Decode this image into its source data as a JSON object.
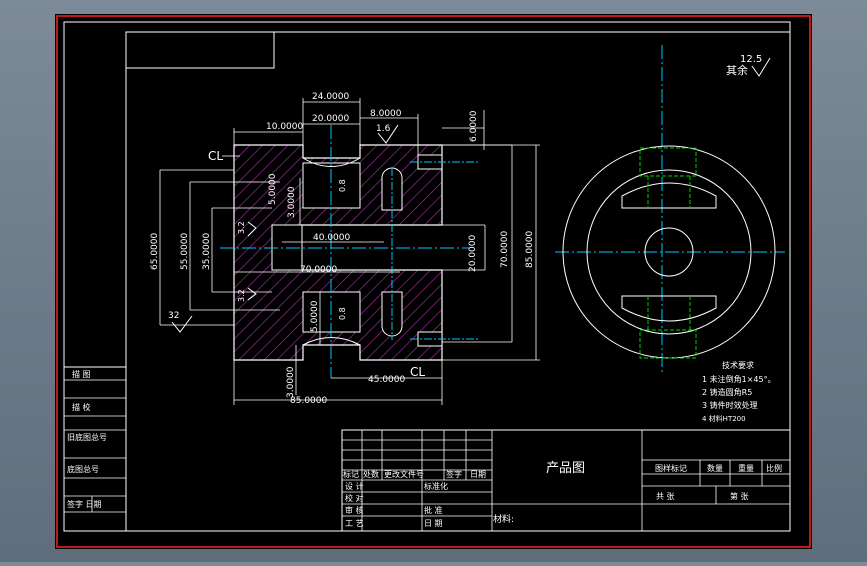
{
  "colors": {
    "background": "#000000",
    "frame": "#ff0000",
    "line": "#ffffff",
    "hatch": "#b030b0",
    "centerline": "#00c8ff",
    "hidden": "#00d000"
  },
  "main_view": {
    "dims": {
      "d24": "24.0000",
      "d20": "20.0000",
      "d8": "8.0000",
      "d10": "10.0000",
      "d6": "6.0000",
      "d5a": "5.0000",
      "d3a": "3.0000",
      "d40": "40.0000",
      "d20b": "20.0000",
      "d70": "70.0000",
      "d70v": "70.0000",
      "d85v": "85.0000",
      "d65": "65.0000",
      "d55": "55.0000",
      "d35": "35.0000",
      "d5b": "5.0000",
      "d45": "45.0000",
      "d3b": "3.0000",
      "d85": "85.0000"
    },
    "labels": {
      "cl_top": "CL",
      "cl_bottom": "CL",
      "rough_16": "1.6",
      "rough_32_left": "32",
      "rough_32_mid_a": "3.2",
      "rough_32_mid_b": "3.2",
      "rough_08_a": "0.8",
      "rough_08_b": "0.8"
    }
  },
  "side_view": {
    "rough_value": "12.5",
    "rough_label": "其余"
  },
  "tech_notes": {
    "title": "技术要求",
    "items": [
      "1 未注倒角1×45°。",
      "2 铸造圆角R5",
      "3 铸件时效处理",
      "4 材料HT200"
    ]
  },
  "left_strip": {
    "rows": [
      "描  图",
      "描  校",
      "旧底图总号",
      "底图总号",
      "签字  日期"
    ]
  },
  "title_block": {
    "product_name": "产品图",
    "material_label": "材料:",
    "rev_headers": [
      "标记",
      "处数",
      "更改文件号",
      "签字",
      "日期"
    ],
    "left_rows": [
      {
        "label": "设  计",
        "value": "标准化"
      },
      {
        "label": "校  对",
        "value": ""
      },
      {
        "label": "审  核",
        "value": "批  准"
      },
      {
        "label": "工  艺",
        "value": "日  期"
      }
    ],
    "stage_headers": [
      "图样标记",
      "数量",
      "重量",
      "比例"
    ],
    "sheet_labels": [
      "共    张",
      "第    张"
    ]
  }
}
